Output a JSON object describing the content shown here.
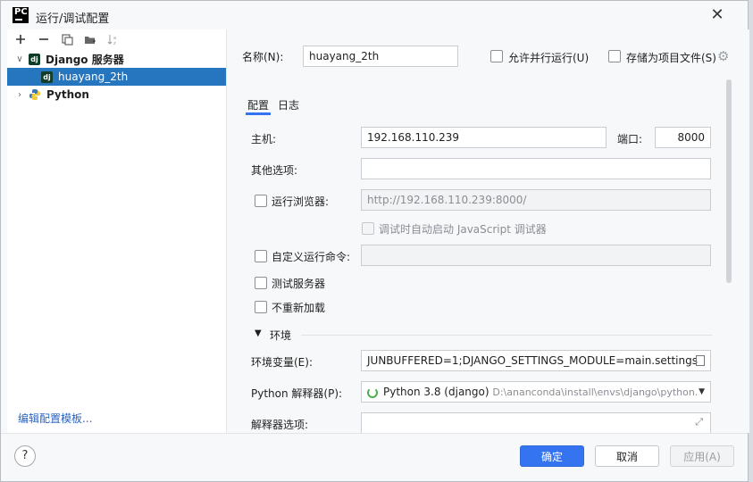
{
  "window": {
    "title": "运行/调试配置",
    "app_logo": "PC"
  },
  "toolbar": {
    "icons": [
      "plus-icon",
      "minus-icon",
      "copy-icon",
      "folder-icon",
      "sort-icon"
    ]
  },
  "tree": {
    "group_label": "Django 服务器",
    "item_label": "huayang_2th",
    "python_label": "Python",
    "dj_icon_text": "dj"
  },
  "footer_link": "编辑配置模板...",
  "form": {
    "name_label": "名称(N):",
    "name_value": "huayang_2th",
    "allow_parallel_label": "允许并行运行(U)",
    "store_as_project_label": "存储为项目文件(S)",
    "tabs": [
      "配置",
      "日志"
    ],
    "host_label": "主机:",
    "host_value": "192.168.110.239",
    "port_label": "端口:",
    "port_value": "8000",
    "other_options_label": "其他选项:",
    "other_options_value": "",
    "run_browser_label": "运行浏览器:",
    "run_browser_url": "http://192.168.110.239:8000/",
    "js_debugger_label": "调试时自动启动 JavaScript 调试器",
    "custom_run_command_label": "自定义运行命令:",
    "custom_run_command_value": "",
    "test_server_label": "测试服务器",
    "no_reload_label": "不重新加载",
    "env_section_label": "环境",
    "env_vars_label": "环境变量(E):",
    "env_vars_value": "JUNBUFFERED=1;DJANGO_SETTINGS_MODULE=main.settings",
    "interpreter_label": "Python 解释器(P):",
    "interpreter_value": "Python 3.8 (django)",
    "interpreter_path": "D:\\ananconda\\install\\envs\\django\\python.",
    "interpreter_options_label": "解释器选项:",
    "interpreter_options_value": ""
  },
  "buttons": {
    "help": "?",
    "ok": "确定",
    "cancel": "取消",
    "apply": "应用(A)"
  },
  "colors": {
    "accent": "#3574f0",
    "selection": "#2675bf",
    "link": "#2a64c4"
  }
}
